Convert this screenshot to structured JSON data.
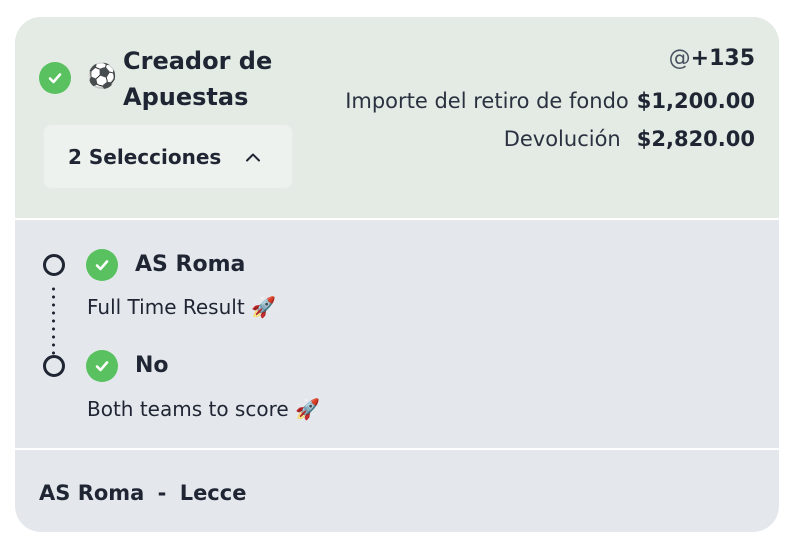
{
  "bet": {
    "title_line1": "Creador de",
    "title_line2": "Apuestas",
    "sport_emoji": "⚽",
    "selections_button": "2 Selecciones",
    "odds_prefix": "@",
    "odds": "+135",
    "stake_label": "Importe del retiro de fondo",
    "stake_value": "$1,200.00",
    "return_label": "Devolución",
    "return_value": "$2,820.00"
  },
  "selections": [
    {
      "name": "AS Roma",
      "market": "Full Time Result 🚀"
    },
    {
      "name": "No",
      "market": "Both teams to score 🚀"
    }
  ],
  "match": {
    "home": "AS Roma",
    "separator": "-",
    "away": "Lecce"
  },
  "colors": {
    "won_check": "#59c15f",
    "header_bg": "#e3ebe4",
    "body_bg": "#e4e8ec"
  },
  "icons": {
    "status": "check-circle-icon",
    "toggle": "chevron-up-icon",
    "leg_marker": "ring-icon"
  }
}
